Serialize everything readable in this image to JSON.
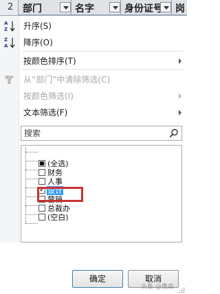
{
  "header": {
    "row_number": "2",
    "columns": [
      {
        "label": "部门"
      },
      {
        "label": "名字"
      },
      {
        "label": "身份证号"
      },
      {
        "label": "岗"
      }
    ]
  },
  "menu": {
    "sort_asc": "升序(S)",
    "sort_desc": "降序(O)",
    "sort_by_color": "按颜色排序(T)",
    "clear_filter": "从“部门”中清除筛选(C)",
    "filter_by_color": "按颜色筛选(I)",
    "text_filter": "文本筛选(F)"
  },
  "search": {
    "placeholder": "搜索"
  },
  "filter_list": {
    "items": [
      {
        "label": "(全选)",
        "state": "partial"
      },
      {
        "label": "财务",
        "state": "unchecked"
      },
      {
        "label": "人事",
        "state": "unchecked"
      },
      {
        "label": "设计",
        "state": "checked",
        "selected": true
      },
      {
        "label": "营销",
        "state": "unchecked"
      },
      {
        "label": "总裁办",
        "state": "unchecked"
      },
      {
        "label": "(空白)",
        "state": "unchecked"
      }
    ]
  },
  "buttons": {
    "ok": "确定",
    "cancel": "取消"
  },
  "watermark": "头条 @奥森",
  "colors": {
    "highlight_box": "#c73232",
    "selection": "#3399ff"
  }
}
